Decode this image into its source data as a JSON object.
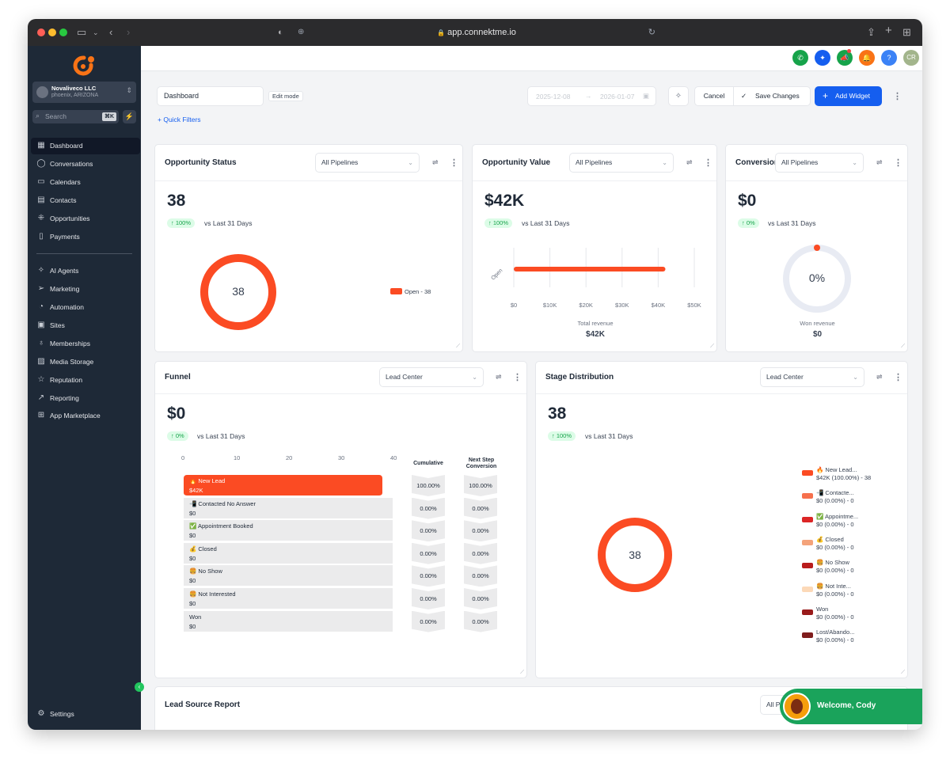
{
  "browser": {
    "url": "app.connektme.io"
  },
  "account": {
    "name": "Novaliveco LLC",
    "location": "phoenix, ARIZONA"
  },
  "search": {
    "placeholder": "Search",
    "shortcut": "⌘K"
  },
  "sidebar": {
    "items": [
      {
        "label": "Dashboard",
        "icon": "dashboard-icon",
        "active": true
      },
      {
        "label": "Conversations",
        "icon": "chat-icon"
      },
      {
        "label": "Calendars",
        "icon": "calendar-icon"
      },
      {
        "label": "Contacts",
        "icon": "contacts-icon"
      },
      {
        "label": "Opportunities",
        "icon": "opportunities-icon"
      },
      {
        "label": "Payments",
        "icon": "payments-icon"
      },
      {
        "label": "AI Agents",
        "icon": "sparkle-icon"
      },
      {
        "label": "Marketing",
        "icon": "send-icon"
      },
      {
        "label": "Automation",
        "icon": "automation-icon"
      },
      {
        "label": "Sites",
        "icon": "sites-icon"
      },
      {
        "label": "Memberships",
        "icon": "membership-icon"
      },
      {
        "label": "Media Storage",
        "icon": "media-icon"
      },
      {
        "label": "Reputation",
        "icon": "star-icon"
      },
      {
        "label": "Reporting",
        "icon": "trend-icon"
      },
      {
        "label": "App Marketplace",
        "icon": "apps-icon"
      }
    ],
    "settings_label": "Settings"
  },
  "topbar": {
    "avatar_initials": "CR"
  },
  "toolbar": {
    "dashboard_name": "Dashboard",
    "edit_mode": "Edit mode",
    "date_start": "2025-12-08",
    "date_end": "2026-01-07",
    "cancel": "Cancel",
    "save": "Save Changes",
    "add_widget": "Add Widget",
    "quick_filters": "Quick Filters"
  },
  "widgets": {
    "opportunity_status": {
      "title": "Opportunity Status",
      "filter": "All Pipelines",
      "value": "38",
      "change": "100%",
      "compare": "vs Last 31 Days",
      "center": "38",
      "legend": "Open - 38"
    },
    "opportunity_value": {
      "title": "Opportunity Value",
      "filter": "All Pipelines",
      "value": "$42K",
      "change": "100%",
      "compare": "vs Last 31 Days",
      "caption": "Total revenue",
      "caption_value": "$42K"
    },
    "conversion": {
      "title": "Conversion",
      "filter": "All Pipelines",
      "value": "$0",
      "change": "0%",
      "compare": "vs Last 31 Days",
      "center": "0%",
      "caption": "Won revenue",
      "caption_value": "$0"
    },
    "funnel": {
      "title": "Funnel",
      "filter": "Lead Center",
      "value": "$0",
      "change": "0%",
      "compare": "vs Last 31 Days",
      "col_cumulative": "Cumulative",
      "col_next": "Next Step Conversion"
    },
    "stage_distribution": {
      "title": "Stage Distribution",
      "filter": "Lead Center",
      "value": "38",
      "change": "100%",
      "compare": "vs Last 31 Days",
      "center": "38"
    },
    "lead_source": {
      "title": "Lead Source Report",
      "filter": "All P"
    }
  },
  "chart_data": [
    {
      "type": "pie",
      "chart": "opportunity-status-donut",
      "categories": [
        "Open"
      ],
      "values": [
        38
      ],
      "colors": [
        "#fb4b23"
      ]
    },
    {
      "type": "bar",
      "orientation": "horizontal",
      "chart": "opportunity-value-bar",
      "categories": [
        "Open"
      ],
      "values": [
        42000
      ],
      "xlim": [
        0,
        50000
      ],
      "xticks": [
        "$0",
        "$10K",
        "$20K",
        "$30K",
        "$40K",
        "$50K"
      ],
      "xlabel": "Total revenue",
      "colors": [
        "#fb4b23"
      ]
    },
    {
      "type": "pie",
      "chart": "conversion-gauge",
      "categories": [
        "Won"
      ],
      "values": [
        0
      ]
    },
    {
      "type": "bar",
      "orientation": "horizontal",
      "chart": "funnel",
      "xticks": [
        "0",
        "10",
        "20",
        "30",
        "40"
      ],
      "xlim": [
        0,
        40
      ],
      "categories": [
        "🔥 New Lead",
        "📲 Contacted   No Answer",
        "✅ Appointment Booked",
        "💰 Closed",
        "🍔 No Show",
        "🍔 Not Interested",
        "Won"
      ],
      "amounts": [
        "$42K",
        "$0",
        "$0",
        "$0",
        "$0",
        "$0",
        "$0"
      ],
      "values": [
        38,
        0,
        0,
        0,
        0,
        0,
        0
      ],
      "cumulative": [
        "100.00%",
        "0.00%",
        "0.00%",
        "0.00%",
        "0.00%",
        "0.00%",
        "0.00%"
      ],
      "next_step": [
        "100.00%",
        "0.00%",
        "0.00%",
        "0.00%",
        "0.00%",
        "0.00%",
        "0.00%"
      ]
    },
    {
      "type": "pie",
      "chart": "stage-distribution-donut",
      "categories": [
        "🔥 New Lead...",
        "📲 Contacte...",
        "✅ Appointme...",
        "💰 Closed",
        "🍔 No Show",
        "🍔 Not Inte...",
        "Won",
        "Lost/Abando..."
      ],
      "labels": [
        "$42K (100.00%) - 38",
        "$0 (0.00%) - 0",
        "$0 (0.00%) - 0",
        "$0 (0.00%) - 0",
        "$0 (0.00%) - 0",
        "$0 (0.00%) - 0",
        "$0 (0.00%) - 0",
        "$0 (0.00%) - 0"
      ],
      "values": [
        38,
        0,
        0,
        0,
        0,
        0,
        0,
        0
      ],
      "colors": [
        "#fb4b23",
        "#f6704d",
        "#dc2626",
        "#f4a37a",
        "#b91c1c",
        "#fcd9b8",
        "#991b1b",
        "#7f1d1d"
      ]
    }
  ],
  "welcome": {
    "text": "Welcome, Cody",
    "badge": "1"
  }
}
